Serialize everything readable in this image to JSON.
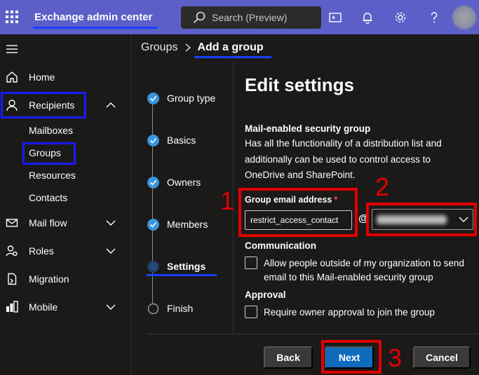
{
  "header": {
    "app_title": "Exchange admin center",
    "search_placeholder": "Search (Preview)"
  },
  "nav": {
    "items": [
      {
        "label": "Home"
      },
      {
        "label": "Recipients"
      },
      {
        "label": "Mail flow"
      },
      {
        "label": "Roles"
      },
      {
        "label": "Migration"
      },
      {
        "label": "Mobile"
      }
    ],
    "recipients_sub": [
      "Mailboxes",
      "Groups",
      "Resources",
      "Contacts"
    ]
  },
  "breadcrumb": {
    "parent": "Groups",
    "current": "Add a group"
  },
  "steps": [
    {
      "label": "Group type",
      "state": "done"
    },
    {
      "label": "Basics",
      "state": "done"
    },
    {
      "label": "Owners",
      "state": "done"
    },
    {
      "label": "Members",
      "state": "done"
    },
    {
      "label": "Settings",
      "state": "current"
    },
    {
      "label": "Finish",
      "state": "pending"
    }
  ],
  "content": {
    "heading": "Edit settings",
    "group_kind_title": "Mail-enabled security group",
    "group_kind_desc": "Has all the functionality of a distribution list and additionally can be used to control access to OneDrive and SharePoint.",
    "email_label": "Group email address",
    "required_mark": "*",
    "email_value": "restrict_access_contact",
    "at_sign": "@",
    "communication_title": "Communication",
    "communication_option": "Allow people outside of my organization to send email to this Mail-enabled security group",
    "approval_title": "Approval",
    "approval_option": "Require owner approval to join the group"
  },
  "annotations": [
    "1",
    "2",
    "3"
  ],
  "footer": {
    "back": "Back",
    "next": "Next",
    "cancel": "Cancel"
  },
  "colors": {
    "topbar": "#5b5fc7",
    "accent_blue": "#0f6cbd",
    "annotation_red": "#e00000",
    "highlight_blue": "#1a1aff"
  }
}
